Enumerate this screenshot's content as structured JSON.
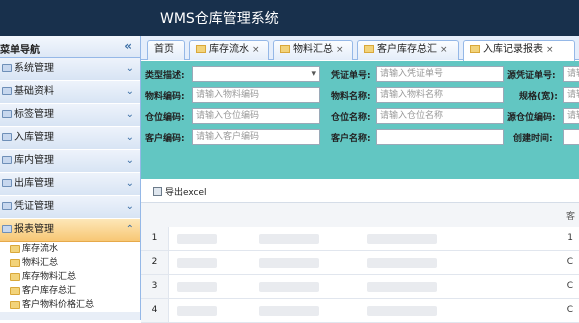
{
  "app": {
    "title": "WMS仓库管理系统"
  },
  "sidebar": {
    "header": "菜单导航",
    "collapse_icon": "double-chevron-left-icon",
    "items": [
      {
        "label": "系统管理"
      },
      {
        "label": "基础资料"
      },
      {
        "label": "标签管理"
      },
      {
        "label": "入库管理"
      },
      {
        "label": "库内管理"
      },
      {
        "label": "出库管理"
      },
      {
        "label": "凭证管理"
      },
      {
        "label": "报表管理",
        "active": true
      }
    ],
    "submenu": [
      {
        "label": "库存流水"
      },
      {
        "label": "物料汇总"
      },
      {
        "label": "库存物料汇总"
      },
      {
        "label": "客户库存总汇"
      },
      {
        "label": "客户物料价格汇总"
      }
    ]
  },
  "tabs": [
    {
      "label": "首页",
      "closable": false
    },
    {
      "label": "库存流水",
      "closable": true
    },
    {
      "label": "物料汇总",
      "closable": true
    },
    {
      "label": "客户库存总汇",
      "closable": true
    },
    {
      "label": "入库记录报表",
      "closable": true,
      "active": true
    }
  ],
  "filter": {
    "type_label": "类型描述:",
    "voucher_label": "凭证单号:",
    "voucher_placeholder": "请输入凭证单号",
    "source_voucher_label": "源凭证单号:",
    "source_voucher_placeholder": "请输",
    "material_code_label": "物料编码:",
    "material_code_placeholder": "请输入物料编码",
    "material_name_label": "物料名称:",
    "material_name_placeholder": "请输入物料名称",
    "spec_label": "规格(宽):",
    "spec_placeholder": "请输",
    "location_code_label": "仓位编码:",
    "location_code_placeholder": "请输入仓位编码",
    "location_name_label": "仓位名称:",
    "location_name_placeholder": "请输入仓位名称",
    "source_location_label": "源仓位编码:",
    "source_location_placeholder": "请输",
    "customer_code_label": "客户编码:",
    "customer_code_placeholder": "请输入客户编码",
    "customer_name_label": "客户名称:",
    "create_time_label": "创建时间:"
  },
  "toolbar": {
    "export_label": "导出excel"
  },
  "grid": {
    "last_col_header": "客",
    "rows": [
      {
        "num": "1",
        "last": "1"
      },
      {
        "num": "2",
        "last": "C"
      },
      {
        "num": "3",
        "last": "C"
      },
      {
        "num": "4",
        "last": "C"
      }
    ]
  }
}
